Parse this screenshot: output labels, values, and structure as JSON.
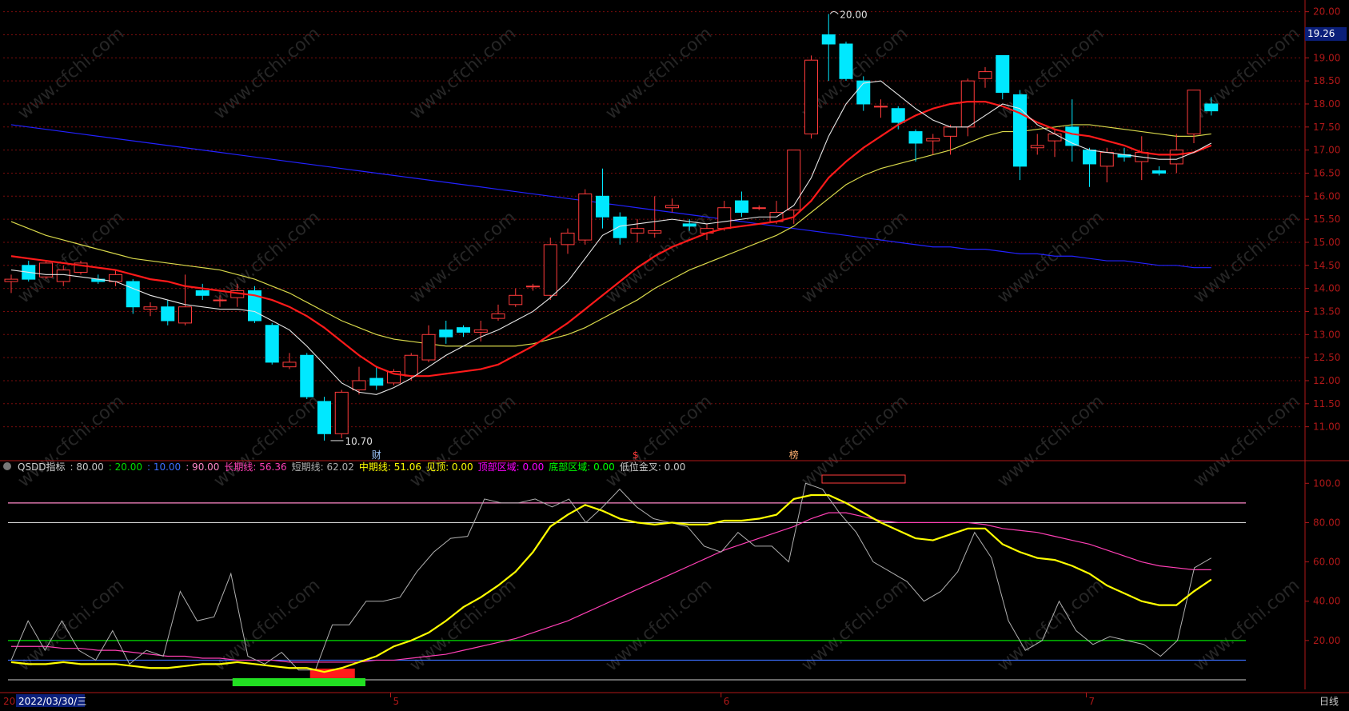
{
  "colors": {
    "background": "#000000",
    "grid": "#7a0c0c",
    "axis": "#b01818",
    "up": "#ff3b3b",
    "down": "#00e8ff",
    "ma5": "#e6e6e6",
    "ma10": "#ff1a1a",
    "ma20": "#d8d84a",
    "ma60": "#2222ff",
    "long_line": "#ff3fb5",
    "short_line": "#b0b0b0",
    "mid_line": "#ffff00",
    "level_80": "#d2d2d2",
    "level_20": "#00e000",
    "level_10": "#3b6fff",
    "level_90": "#ff88c8",
    "price_tag_bg": "#0b1f7a",
    "watermark": "#262626"
  },
  "watermark_text": "www.cfchi.com",
  "price_tag": "19.26",
  "max_label": "20.00",
  "min_label": "10.70",
  "event_marks": [
    "财",
    "$",
    "榜"
  ],
  "legend": {
    "name": "QSDD指标",
    "items": [
      {
        "text": ": 80.00",
        "color": "#c8c8c8"
      },
      {
        "text": ": 20.00",
        "color": "#00e000"
      },
      {
        "text": ": 10.00",
        "color": "#3b6fff"
      },
      {
        "text": ": 90.00",
        "color": "#ff88c8"
      },
      {
        "text": "长期线: 56.36",
        "color": "#ff3fb5"
      },
      {
        "text": "短期线: 62.02",
        "color": "#b0b0b0"
      },
      {
        "text": "中期线: 51.06",
        "color": "#ffff00"
      },
      {
        "text": "见顶: 0.00",
        "color": "#ffff00"
      },
      {
        "text": "顶部区域: 0.00",
        "color": "#ff00ff"
      },
      {
        "text": "底部区域: 0.00",
        "color": "#00ff00"
      },
      {
        "text": "低位金叉: 0.00",
        "color": "#c8c8c8"
      }
    ]
  },
  "date_axis": {
    "current": "2022/03/30/三",
    "left_stub": "20",
    "months": [
      {
        "label": "5",
        "i": 22
      },
      {
        "label": "6",
        "i": 41
      },
      {
        "label": "7",
        "i": 62
      }
    ],
    "period": "日线"
  },
  "chart_data": [
    {
      "type": "candlestick",
      "title": "",
      "ylim": [
        10.3,
        20.15
      ],
      "yticks": [
        "11.00",
        "11.50",
        "12.00",
        "12.50",
        "13.00",
        "13.50",
        "14.00",
        "14.50",
        "15.00",
        "15.50",
        "16.00",
        "16.50",
        "17.00",
        "17.50",
        "18.00",
        "18.50",
        "19.00",
        "19.50",
        "20.00"
      ],
      "candles": [
        [
          14.15,
          14.2,
          13.9,
          14.3
        ],
        [
          14.5,
          14.2,
          14.15,
          14.6
        ],
        [
          14.25,
          14.55,
          14.2,
          14.6
        ],
        [
          14.15,
          14.4,
          14.05,
          14.5
        ],
        [
          14.35,
          14.55,
          14.3,
          14.6
        ],
        [
          14.2,
          14.15,
          14.1,
          14.3
        ],
        [
          14.15,
          14.3,
          14.05,
          14.4
        ],
        [
          14.15,
          13.6,
          13.45,
          14.2
        ],
        [
          13.55,
          13.6,
          13.4,
          13.7
        ],
        [
          13.6,
          13.3,
          13.2,
          13.75
        ],
        [
          13.25,
          13.6,
          13.2,
          14.3
        ],
        [
          13.95,
          13.85,
          13.75,
          14.1
        ],
        [
          13.75,
          13.75,
          13.6,
          13.85
        ],
        [
          13.8,
          13.95,
          13.6,
          14.1
        ],
        [
          13.95,
          13.3,
          13.25,
          14.05
        ],
        [
          13.2,
          12.4,
          12.35,
          13.25
        ],
        [
          12.3,
          12.4,
          12.25,
          12.6
        ],
        [
          12.55,
          11.65,
          11.6,
          12.6
        ],
        [
          11.55,
          10.85,
          10.7,
          11.65
        ],
        [
          10.85,
          11.75,
          10.75,
          11.8
        ],
        [
          11.8,
          12.0,
          11.7,
          12.3
        ],
        [
          12.05,
          11.9,
          11.8,
          12.3
        ],
        [
          11.95,
          12.2,
          11.9,
          12.25
        ],
        [
          12.1,
          12.55,
          12.0,
          12.6
        ],
        [
          12.45,
          13.0,
          12.4,
          13.2
        ],
        [
          13.1,
          12.95,
          12.8,
          13.3
        ],
        [
          13.15,
          13.05,
          12.95,
          13.2
        ],
        [
          13.05,
          13.1,
          12.85,
          13.3
        ],
        [
          13.35,
          13.45,
          13.3,
          13.65
        ],
        [
          13.65,
          13.85,
          13.6,
          14.0
        ],
        [
          14.05,
          14.05,
          13.95,
          14.1
        ],
        [
          13.85,
          14.95,
          13.75,
          15.1
        ],
        [
          14.95,
          15.2,
          14.75,
          15.3
        ],
        [
          15.05,
          16.05,
          14.95,
          16.15
        ],
        [
          16.0,
          15.55,
          15.3,
          16.6
        ],
        [
          15.55,
          15.1,
          14.95,
          15.65
        ],
        [
          15.2,
          15.3,
          15.0,
          15.5
        ],
        [
          15.2,
          15.25,
          15.1,
          16.0
        ],
        [
          15.75,
          15.8,
          15.65,
          15.95
        ],
        [
          15.4,
          15.35,
          15.25,
          15.5
        ],
        [
          15.2,
          15.3,
          15.05,
          15.4
        ],
        [
          15.3,
          15.75,
          15.25,
          15.9
        ],
        [
          15.9,
          15.65,
          15.55,
          16.1
        ],
        [
          15.75,
          15.75,
          15.7,
          15.8
        ],
        [
          15.45,
          15.65,
          15.4,
          15.9
        ],
        [
          15.7,
          17.0,
          15.4,
          17.0
        ],
        [
          17.35,
          18.95,
          17.25,
          19.05
        ],
        [
          19.5,
          19.3,
          18.5,
          19.95
        ],
        [
          19.3,
          18.55,
          18.5,
          19.35
        ],
        [
          18.5,
          18.0,
          17.85,
          18.6
        ],
        [
          17.95,
          17.95,
          17.7,
          18.1
        ],
        [
          17.9,
          17.6,
          17.45,
          17.95
        ],
        [
          17.4,
          17.15,
          16.75,
          17.45
        ],
        [
          17.2,
          17.25,
          16.9,
          17.35
        ],
        [
          17.3,
          17.5,
          16.9,
          17.55
        ],
        [
          17.5,
          18.5,
          17.3,
          18.55
        ],
        [
          18.55,
          18.7,
          18.35,
          18.8
        ],
        [
          19.05,
          18.25,
          18.1,
          19.05
        ],
        [
          18.2,
          16.65,
          16.35,
          18.3
        ],
        [
          17.05,
          17.1,
          16.9,
          17.35
        ],
        [
          17.2,
          17.35,
          16.85,
          17.45
        ],
        [
          17.5,
          17.1,
          16.75,
          18.1
        ],
        [
          17.0,
          16.7,
          16.2,
          17.05
        ],
        [
          16.65,
          16.95,
          16.3,
          17.05
        ],
        [
          16.9,
          16.85,
          16.75,
          17.05
        ],
        [
          16.75,
          16.95,
          16.35,
          17.3
        ],
        [
          16.55,
          16.5,
          16.45,
          16.65
        ],
        [
          16.7,
          17.0,
          16.5,
          17.35
        ],
        [
          17.35,
          18.3,
          17.15,
          18.3
        ],
        [
          18.0,
          17.85,
          17.75,
          18.15
        ]
      ],
      "ma5": [
        14.4,
        14.35,
        14.3,
        14.3,
        14.25,
        14.2,
        14.15,
        14.0,
        13.85,
        13.75,
        13.65,
        13.6,
        13.55,
        13.55,
        13.5,
        13.3,
        13.1,
        12.75,
        12.35,
        11.95,
        11.75,
        11.7,
        11.85,
        12.05,
        12.3,
        12.55,
        12.75,
        12.95,
        13.1,
        13.3,
        13.5,
        13.8,
        14.15,
        14.65,
        15.15,
        15.35,
        15.4,
        15.45,
        15.5,
        15.45,
        15.4,
        15.45,
        15.5,
        15.55,
        15.55,
        15.8,
        16.4,
        17.3,
        18.0,
        18.45,
        18.5,
        18.2,
        17.9,
        17.65,
        17.5,
        17.5,
        17.75,
        18.0,
        17.9,
        17.55,
        17.35,
        17.15,
        17.0,
        16.95,
        16.9,
        16.85,
        16.8,
        16.8,
        16.95,
        17.15
      ],
      "ma10": [
        14.7,
        14.65,
        14.6,
        14.55,
        14.5,
        14.45,
        14.4,
        14.3,
        14.2,
        14.15,
        14.05,
        14.0,
        13.95,
        13.9,
        13.85,
        13.75,
        13.6,
        13.4,
        13.15,
        12.85,
        12.55,
        12.3,
        12.15,
        12.1,
        12.1,
        12.15,
        12.2,
        12.25,
        12.35,
        12.55,
        12.75,
        13.0,
        13.25,
        13.55,
        13.85,
        14.15,
        14.45,
        14.7,
        14.9,
        15.05,
        15.2,
        15.3,
        15.35,
        15.4,
        15.45,
        15.55,
        15.9,
        16.4,
        16.75,
        17.05,
        17.3,
        17.55,
        17.75,
        17.9,
        18.0,
        18.05,
        18.05,
        17.95,
        17.8,
        17.6,
        17.45,
        17.35,
        17.3,
        17.2,
        17.1,
        16.95,
        16.9,
        16.9,
        16.95,
        17.1
      ],
      "ma20": [
        15.45,
        15.3,
        15.15,
        15.05,
        14.95,
        14.85,
        14.75,
        14.65,
        14.6,
        14.55,
        14.5,
        14.45,
        14.4,
        14.3,
        14.2,
        14.05,
        13.9,
        13.7,
        13.5,
        13.3,
        13.15,
        13.0,
        12.9,
        12.85,
        12.8,
        12.75,
        12.75,
        12.75,
        12.75,
        12.75,
        12.8,
        12.9,
        13.0,
        13.15,
        13.35,
        13.55,
        13.75,
        14.0,
        14.2,
        14.4,
        14.55,
        14.7,
        14.85,
        15.0,
        15.15,
        15.35,
        15.65,
        15.95,
        16.25,
        16.45,
        16.6,
        16.7,
        16.8,
        16.9,
        17.0,
        17.15,
        17.3,
        17.4,
        17.4,
        17.45,
        17.5,
        17.55,
        17.55,
        17.5,
        17.45,
        17.4,
        17.35,
        17.3,
        17.3,
        17.35
      ],
      "ma60": [
        17.55,
        17.5,
        17.45,
        17.4,
        17.35,
        17.3,
        17.25,
        17.2,
        17.15,
        17.1,
        17.05,
        17.0,
        16.95,
        16.9,
        16.85,
        16.8,
        16.75,
        16.7,
        16.65,
        16.6,
        16.55,
        16.5,
        16.45,
        16.4,
        16.35,
        16.3,
        16.25,
        16.2,
        16.15,
        16.1,
        16.05,
        16.0,
        15.95,
        15.9,
        15.85,
        15.8,
        15.75,
        15.7,
        15.65,
        15.6,
        15.55,
        15.5,
        15.45,
        15.4,
        15.35,
        15.3,
        15.25,
        15.2,
        15.15,
        15.1,
        15.05,
        15.0,
        14.95,
        14.9,
        14.9,
        14.85,
        14.85,
        14.8,
        14.75,
        14.75,
        14.7,
        14.7,
        14.65,
        14.6,
        14.6,
        14.55,
        14.5,
        14.5,
        14.45,
        14.45
      ]
    },
    {
      "type": "line",
      "title": "",
      "ylim": [
        0,
        105
      ],
      "yticks": [
        "20.00",
        "40.00",
        "60.00",
        "80.00",
        "100.0"
      ],
      "levels": [
        90,
        80,
        20,
        10
      ],
      "series": [
        {
          "name": "短期线",
          "values": [
            10,
            30,
            15,
            30,
            15,
            10,
            25,
            8,
            15,
            12,
            45,
            30,
            32,
            54,
            12,
            8,
            14,
            5,
            5,
            28,
            28,
            40,
            40,
            42,
            55,
            65,
            72,
            73,
            92,
            90,
            90,
            92,
            88,
            92,
            80,
            88,
            97,
            88,
            82,
            80,
            78,
            68,
            65,
            75,
            68,
            68,
            60,
            100,
            97,
            85,
            75,
            60,
            55,
            50,
            40,
            45,
            55,
            75,
            62,
            30,
            15,
            20,
            40,
            25,
            18,
            22,
            20,
            18,
            12,
            20,
            57,
            62
          ]
        },
        {
          "name": "中期线",
          "values": [
            9,
            8,
            8,
            9,
            8,
            8,
            8,
            7,
            6,
            6,
            7,
            8,
            8,
            9,
            8,
            7,
            6,
            6,
            4,
            6,
            9,
            12,
            17,
            20,
            24,
            30,
            37,
            42,
            48,
            55,
            65,
            78,
            84,
            89,
            86,
            82,
            80,
            79,
            80,
            79,
            79,
            81,
            81,
            82,
            84,
            92,
            94,
            94,
            90,
            85,
            80,
            76,
            72,
            71,
            74,
            77,
            77,
            69,
            65,
            62,
            61,
            58,
            54,
            48,
            44,
            40,
            38,
            38,
            45,
            51
          ]
        },
        {
          "name": "长期线",
          "values": [
            17,
            17,
            17,
            16,
            16,
            15,
            15,
            14,
            13,
            12,
            12,
            11,
            11,
            10,
            10,
            10,
            9,
            9,
            9,
            9,
            9,
            10,
            10,
            11,
            12,
            13,
            15,
            17,
            19,
            21,
            24,
            27,
            30,
            34,
            38,
            42,
            46,
            50,
            54,
            58,
            62,
            66,
            69,
            72,
            75,
            78,
            82,
            85,
            85,
            83,
            81,
            80,
            80,
            80,
            80,
            80,
            79,
            77,
            76,
            75,
            73,
            71,
            69,
            66,
            63,
            60,
            58,
            57,
            56,
            56
          ]
        }
      ]
    }
  ]
}
